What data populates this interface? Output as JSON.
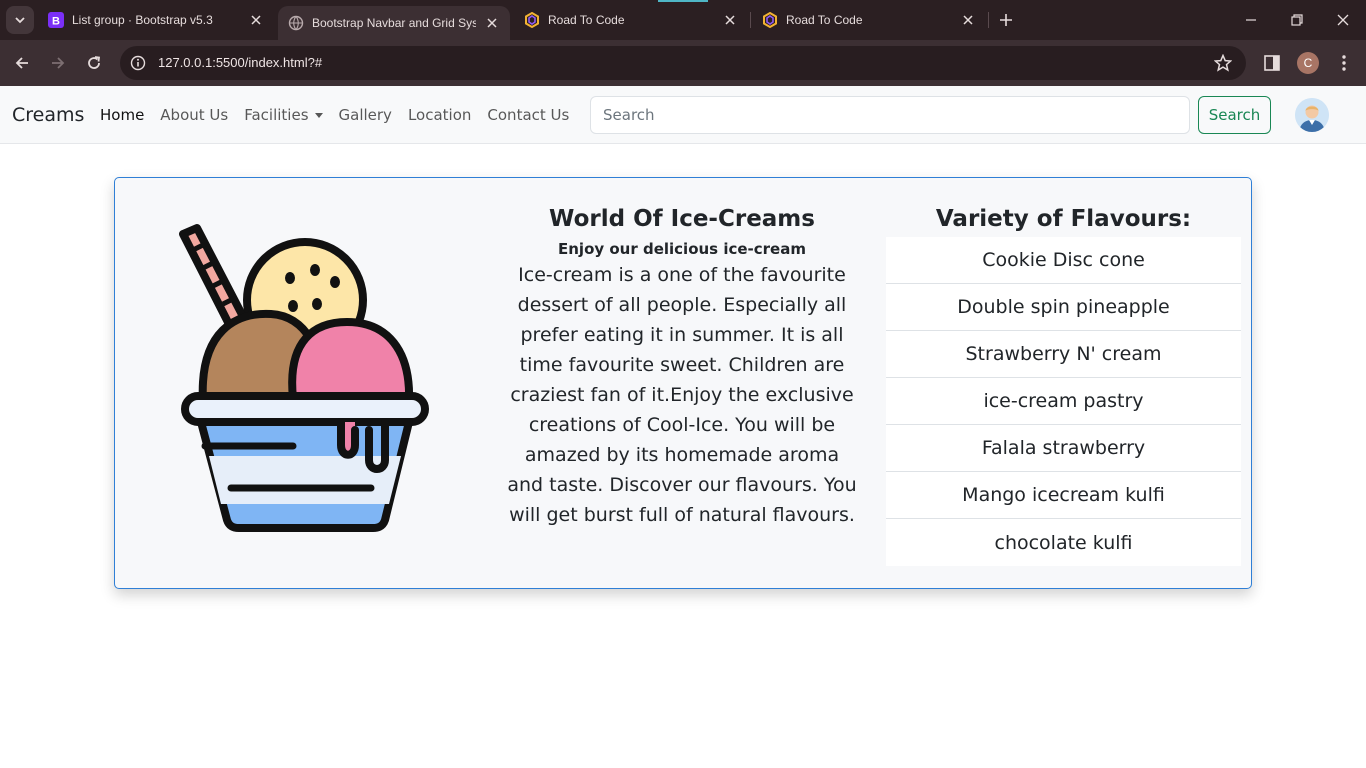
{
  "browser": {
    "tabs": [
      {
        "title": "List group · Bootstrap v5.3",
        "favicon": "bootstrap-icon",
        "active": false
      },
      {
        "title": "Bootstrap Navbar and Grid System",
        "favicon": "globe-icon",
        "active": true
      },
      {
        "title": "Road To Code",
        "favicon": "road-to-code-icon",
        "active": false
      },
      {
        "title": "Road To Code",
        "favicon": "road-to-code-icon",
        "active": false
      }
    ],
    "url": "127.0.0.1:5500/index.html?#",
    "profile_initial": "C"
  },
  "navbar": {
    "brand": "Creams",
    "links": [
      {
        "label": "Home",
        "active": true
      },
      {
        "label": "About Us"
      },
      {
        "label": "Facilities",
        "dropdown": true
      },
      {
        "label": "Gallery"
      },
      {
        "label": "Location"
      },
      {
        "label": "Contact Us"
      }
    ],
    "search_placeholder": "Search",
    "search_button": "Search"
  },
  "card": {
    "title": "World Of Ice-Creams",
    "subtitle": "Enjoy our delicious ice-cream",
    "body": "Ice-cream is a one of the favourite dessert of all people. Especially all prefer eating it in summer. It is all time favourite sweet. Children are craziest fan of it.Enjoy the exclusive creations of Cool-Ice. You will be amazed by its homemade aroma and taste. Discover our flavours. You will get burst full of natural flavours.",
    "flavours_title": "Variety of Flavours:",
    "flavours": [
      "Cookie Disc cone",
      "Double spin pineapple",
      "Strawberry N' cream",
      "ice-cream pastry",
      "Falala strawberry",
      "Mango icecream kulfi",
      "chocolate kulfi"
    ]
  },
  "colors": {
    "card_border": "#2f7fd6",
    "search_button": "#198754"
  }
}
